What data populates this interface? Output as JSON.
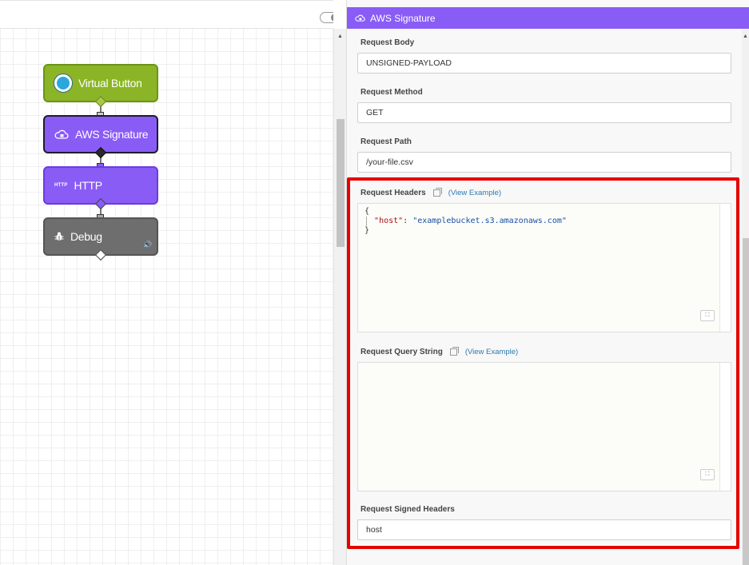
{
  "canvas": {
    "nodes": [
      {
        "label": "Virtual Button",
        "icon": "virtual-button-icon"
      },
      {
        "label": "AWS Signature",
        "icon": "cloud-lock-icon"
      },
      {
        "label": "HTTP",
        "tag": "HTTP",
        "icon": "http-icon"
      },
      {
        "label": "Debug",
        "icon": "bug-icon"
      }
    ]
  },
  "panel": {
    "title": "AWS Signature",
    "fields": {
      "request_body": {
        "label": "Request Body",
        "value": "UNSIGNED-PAYLOAD"
      },
      "request_method": {
        "label": "Request Method",
        "value": "GET"
      },
      "request_path": {
        "label": "Request Path",
        "value": "/your-file.csv"
      },
      "request_headers": {
        "label": "Request Headers",
        "link": "(View Example)",
        "code_open": "{",
        "code_key": "\"host\"",
        "code_colon": ": ",
        "code_value": "\"examplebucket.s3.amazonaws.com\"",
        "code_close": "}"
      },
      "request_query_string": {
        "label": "Request Query String",
        "link": "(View Example)"
      },
      "request_signed_headers": {
        "label": "Request Signed Headers",
        "value": "host"
      }
    }
  },
  "colors": {
    "accent_purple": "#8a5cf6",
    "virtual_button_green": "#8bb526",
    "debug_gray": "#6e6e6e",
    "highlight_red": "#e60000"
  }
}
